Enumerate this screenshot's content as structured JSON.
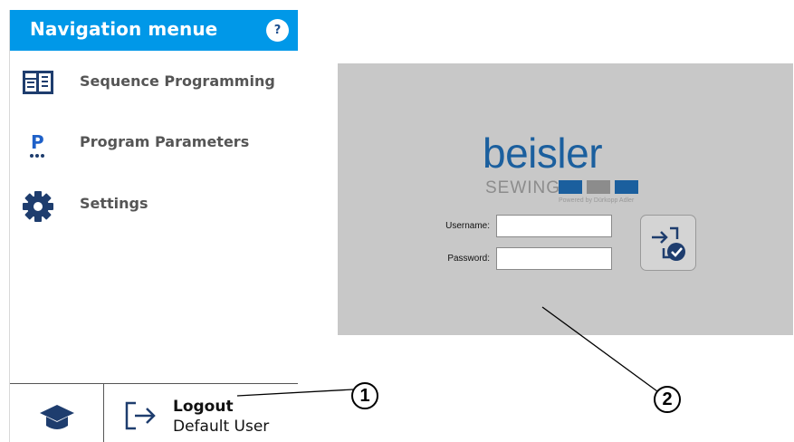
{
  "nav": {
    "title": "Navigation menue",
    "help": "?",
    "items": [
      {
        "label": "Sequence Programming",
        "icon": "sequence-programming-icon"
      },
      {
        "label": "Program Parameters",
        "icon": "program-parameters-icon"
      },
      {
        "label": "Settings",
        "icon": "gear-icon"
      }
    ],
    "footer": {
      "hat_icon": "graduation-cap-icon",
      "logout_icon": "logout-icon",
      "logout_title": "Logout",
      "user": "Default User"
    }
  },
  "login": {
    "brand": "beisler",
    "brand_sub": "SEWING",
    "powered_by": "Powered by Dürkopp Adler",
    "username_label": "Username:",
    "password_label": "Password:",
    "username_value": "",
    "password_value": "",
    "login_icon": "login-check-icon"
  },
  "callouts": [
    "1",
    "2"
  ],
  "colors": {
    "header_blue": "#0098e8",
    "icon_navy": "#1e3d6e",
    "brand_blue": "#1b5f9e",
    "login_bg": "#c8c8c8"
  }
}
